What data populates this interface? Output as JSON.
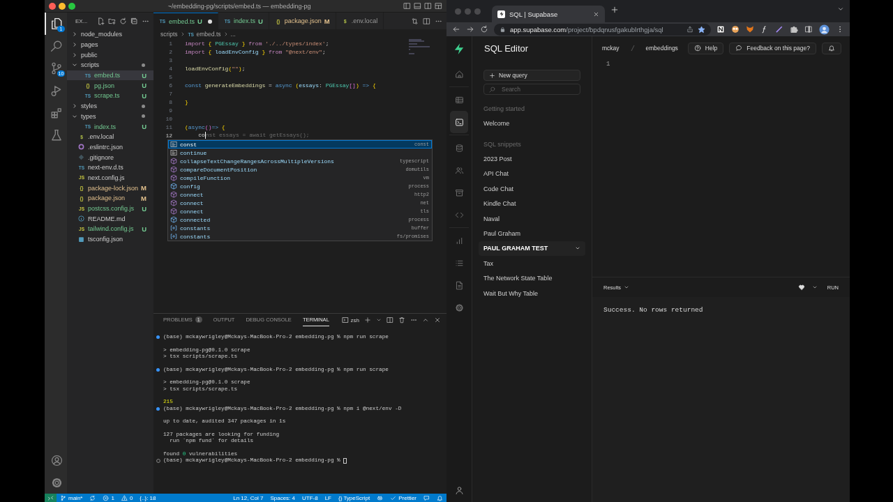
{
  "vscode": {
    "title": "~/embedding-pg/scripts/embed.ts — embedding-pg",
    "activity_bar": [
      {
        "kind": "explorer",
        "selected": true,
        "badge": "1"
      },
      {
        "kind": "search",
        "selected": false
      },
      {
        "kind": "source-control",
        "selected": false,
        "badge": "10"
      },
      {
        "kind": "run-debug",
        "selected": false
      },
      {
        "kind": "extensions",
        "selected": false
      },
      {
        "kind": "testing",
        "selected": false
      }
    ],
    "activity_bar_bottom": [
      {
        "kind": "account"
      },
      {
        "kind": "settings"
      }
    ],
    "explorer": {
      "title": "EX...",
      "tree": [
        {
          "label": "node_modules",
          "kind": "folder",
          "expanded": false,
          "modified": false,
          "selected": false
        },
        {
          "label": "pages",
          "kind": "folder",
          "expanded": false,
          "modified": false,
          "selected": false
        },
        {
          "label": "public",
          "kind": "folder",
          "expanded": false,
          "modified": false,
          "selected": false
        },
        {
          "label": "scripts",
          "kind": "folder",
          "expanded": true,
          "modified": true,
          "selected": false,
          "children": [
            {
              "label": "embed.ts",
              "kind": "ts",
              "icon_text": "TS",
              "status": "U",
              "color": "#73c991",
              "selected": true
            },
            {
              "label": "pg.json",
              "kind": "json",
              "icon_text": "{}",
              "status": "U",
              "color": "#73c991",
              "selected": false
            },
            {
              "label": "scrape.ts",
              "kind": "ts",
              "icon_text": "TS",
              "status": "U",
              "color": "#73c991",
              "selected": false
            }
          ]
        },
        {
          "label": "styles",
          "kind": "folder",
          "expanded": false,
          "modified": true,
          "selected": false
        },
        {
          "label": "types",
          "kind": "folder",
          "expanded": true,
          "modified": true,
          "selected": false,
          "children": [
            {
              "label": "index.ts",
              "kind": "ts",
              "icon_text": "TS",
              "status": "U",
              "color": "#73c991",
              "selected": false
            }
          ]
        },
        {
          "label": ".env.local",
          "kind": "env",
          "icon_text": "$",
          "selected": false
        },
        {
          "label": ".eslintrc.json",
          "kind": "eslint",
          "selected": false
        },
        {
          "label": ".gitignore",
          "kind": "git",
          "selected": false
        },
        {
          "label": "next-env.d.ts",
          "kind": "ts",
          "icon_text": "TS",
          "selected": false
        },
        {
          "label": "next.config.js",
          "kind": "js",
          "icon_text": "JS",
          "selected": false
        },
        {
          "label": "package-lock.json",
          "kind": "json",
          "icon_text": "{}",
          "status": "M",
          "color": "#e2c08d",
          "selected": false
        },
        {
          "label": "package.json",
          "kind": "json",
          "icon_text": "{}",
          "status": "M",
          "color": "#e2c08d",
          "selected": false
        },
        {
          "label": "postcss.config.js",
          "kind": "js",
          "icon_text": "JS",
          "status": "U",
          "color": "#73c991",
          "selected": false
        },
        {
          "label": "README.md",
          "kind": "info",
          "selected": false
        },
        {
          "label": "tailwind.config.js",
          "kind": "js",
          "icon_text": "JS",
          "status": "U",
          "color": "#73c991",
          "selected": false
        },
        {
          "label": "tsconfig.json",
          "kind": "tsconfig",
          "selected": false
        }
      ]
    },
    "tabs": [
      {
        "label": "embed.ts",
        "kind": "ts",
        "icon_text": "TS",
        "status": "U",
        "color": "#73c991",
        "dirty": true,
        "selected": true
      },
      {
        "label": "index.ts",
        "kind": "ts",
        "icon_text": "TS",
        "status": "U",
        "color": "#73c991",
        "dirty": false,
        "selected": false
      },
      {
        "label": "package.json",
        "kind": "json",
        "icon_text": "{}",
        "status": "M",
        "color": "#e2c08d",
        "dirty": false,
        "selected": false
      },
      {
        "label": ".env.local",
        "kind": "env",
        "icon_text": "$",
        "dirty": false,
        "selected": false
      }
    ],
    "breadcrumb": [
      {
        "label": "scripts"
      },
      {
        "label": "embed.ts",
        "icon_text": "TS"
      },
      {
        "label": "..."
      }
    ],
    "lines": [
      {
        "number": "1",
        "tokens": [
          {
            "text": "import ",
            "kind": "kw"
          },
          {
            "text": "{ ",
            "kind": "brace"
          },
          {
            "text": "PGEssay ",
            "kind": "type"
          },
          {
            "text": "} ",
            "kind": "brace"
          },
          {
            "text": "from ",
            "kind": "kw"
          },
          {
            "text": "'./../types/index'",
            "kind": "str"
          },
          {
            "text": ";",
            "kind": "plain"
          }
        ]
      },
      {
        "number": "2",
        "tokens": [
          {
            "text": "import ",
            "kind": "kw"
          },
          {
            "text": "{ ",
            "kind": "brace"
          },
          {
            "text": "loadEnvConfig ",
            "kind": "var"
          },
          {
            "text": "} ",
            "kind": "brace"
          },
          {
            "text": "from ",
            "kind": "kw"
          },
          {
            "text": "\"@next/env\"",
            "kind": "str"
          },
          {
            "text": ";",
            "kind": "plain"
          }
        ]
      },
      {
        "number": "3"
      },
      {
        "number": "4",
        "tokens": [
          {
            "text": "loadEnvConfig",
            "kind": "fn"
          },
          {
            "text": "(",
            "kind": "brace"
          },
          {
            "text": "\"\"",
            "kind": "str"
          },
          {
            "text": ")",
            "kind": "brace"
          },
          {
            "text": ";",
            "kind": "plain"
          }
        ]
      },
      {
        "number": "5"
      },
      {
        "number": "6",
        "tokens": [
          {
            "text": "const ",
            "kind": "storage"
          },
          {
            "text": "generateEmbeddings ",
            "kind": "fn"
          },
          {
            "text": "= ",
            "kind": "plain"
          },
          {
            "text": "async ",
            "kind": "storage"
          },
          {
            "text": "(",
            "kind": "brace"
          },
          {
            "text": "essays",
            "kind": "var"
          },
          {
            "text": ": ",
            "kind": "plain"
          },
          {
            "text": "PGEssay",
            "kind": "type"
          },
          {
            "text": "[]",
            "kind": "bracket"
          },
          {
            "text": ") ",
            "kind": "brace"
          },
          {
            "text": "=> ",
            "kind": "storage"
          },
          {
            "text": "{",
            "kind": "brace"
          }
        ]
      },
      {
        "number": "7"
      },
      {
        "number": "8",
        "tokens": [
          {
            "text": "}",
            "kind": "brace"
          }
        ]
      },
      {
        "number": "9"
      },
      {
        "number": "10"
      },
      {
        "number": "11",
        "tokens": [
          {
            "text": "(",
            "kind": "brace"
          },
          {
            "text": "async",
            "kind": "storage"
          },
          {
            "text": "()",
            "kind": "bracket"
          },
          {
            "text": "=> ",
            "kind": "storage"
          },
          {
            "text": "{",
            "kind": "brace"
          }
        ]
      },
      {
        "number": "12",
        "current": true,
        "tokens": [
          {
            "text": "    co",
            "kind": "plain"
          },
          {
            "text": "nst essays = await getEssays();",
            "kind": "ghost"
          }
        ]
      }
    ],
    "suggestions": [
      {
        "label": "const",
        "kind": "keyword",
        "detail": "const",
        "selected": true
      },
      {
        "label": "continue",
        "kind": "keyword",
        "selected": false
      },
      {
        "label": "collapseTextChangeRangesAcrossMultipleVersions",
        "kind": "method",
        "detail": "typescript",
        "selected": false
      },
      {
        "label": "compareDocumentPosition",
        "kind": "method",
        "detail": "domutils",
        "selected": false
      },
      {
        "label": "compileFunction",
        "kind": "method",
        "detail": "vm",
        "selected": false
      },
      {
        "label": "config",
        "kind": "property",
        "detail": "process",
        "selected": false
      },
      {
        "label": "connect",
        "kind": "method",
        "detail": "http2",
        "selected": false
      },
      {
        "label": "connect",
        "kind": "method",
        "detail": "net",
        "selected": false
      },
      {
        "label": "connect",
        "kind": "method",
        "detail": "tls",
        "selected": false
      },
      {
        "label": "connected",
        "kind": "property",
        "detail": "process",
        "selected": false
      },
      {
        "label": "constants",
        "kind": "variable",
        "detail": "buffer",
        "selected": false
      },
      {
        "label": "constants",
        "kind": "variable",
        "detail": "fs/promises",
        "selected": false
      }
    ],
    "panel_tabs": [
      {
        "label": "PROBLEMS",
        "badge": "1",
        "selected": false
      },
      {
        "label": "OUTPUT",
        "selected": false
      },
      {
        "label": "DEBUG CONSOLE",
        "selected": false
      },
      {
        "label": "TERMINAL",
        "selected": true
      }
    ],
    "terminal_name": "zsh",
    "terminal_blocks": [
      [
        {
          "text": "(base) mckaywrigley@Mckays-MacBook-Pro-2 embedding-pg % npm run scrape",
          "kind": "prompt-done"
        }
      ],
      [
        {
          "text": "> embedding-pg@0.1.0 scrape"
        },
        {
          "text": "> tsx scripts/scrape.ts"
        }
      ],
      [
        {
          "text": "(base) mckaywrigley@Mckays-MacBook-Pro-2 embedding-pg % npm run scrape",
          "kind": "prompt-done"
        }
      ],
      [
        {
          "text": "> embedding-pg@0.1.0 scrape"
        },
        {
          "text": "> tsx scripts/scrape.ts"
        }
      ],
      [
        {
          "segments": [
            {
              "text": "215",
              "kind": "number"
            }
          ]
        },
        {
          "text": "(base) mckaywrigley@Mckays-MacBook-Pro-2 embedding-pg % npm i @next/env -D",
          "kind": "prompt-done"
        }
      ],
      [
        {
          "text": "up to date, audited 347 packages in 1s"
        }
      ],
      [
        {
          "text": "127 packages are looking for funding"
        },
        {
          "text": "  run `npm fund` for details"
        }
      ],
      [
        {
          "segments": [
            {
              "text": "found ",
              "kind": "plain"
            },
            {
              "text": "0",
              "kind": "success"
            },
            {
              "text": " vulnerabilities",
              "kind": "plain"
            }
          ]
        },
        {
          "text": "(base) mckaywrigley@Mckays-MacBook-Pro-2 embedding-pg % ",
          "kind": "prompt-current",
          "cursor": true
        }
      ]
    ],
    "status_left": [
      {
        "kind": "remote"
      },
      {
        "kind": "branch",
        "text": "main*"
      },
      {
        "kind": "sync"
      },
      {
        "kind": "errors",
        "text": "1"
      },
      {
        "kind": "warnings",
        "text": "0"
      },
      {
        "kind": "text",
        "text": "{..}: 18"
      }
    ],
    "status_right": [
      {
        "kind": "text",
        "text": "Ln 12, Col 7"
      },
      {
        "kind": "text",
        "text": "Spaces: 4"
      },
      {
        "kind": "text",
        "text": "UTF-8"
      },
      {
        "kind": "text",
        "text": "LF"
      },
      {
        "kind": "text",
        "text": "{} TypeScript"
      },
      {
        "kind": "copilot"
      },
      {
        "kind": "check",
        "text": "Prettier"
      },
      {
        "kind": "feedback"
      },
      {
        "kind": "bell"
      }
    ]
  },
  "browser": {
    "tab_title": "SQL | Supabase",
    "url_host": "app.supabase.com",
    "url_path": "/project/bpdqnusfgakublrthgja/sql",
    "bookmarked": true
  },
  "supabase": {
    "nav": [
      {
        "items": [
          {
            "kind": "home",
            "selected": false
          }
        ]
      },
      {
        "items": [
          {
            "kind": "table",
            "selected": false
          },
          {
            "kind": "sql",
            "selected": true
          }
        ]
      },
      {
        "items": [
          {
            "kind": "database",
            "selected": false
          },
          {
            "kind": "users",
            "selected": false
          },
          {
            "kind": "storage",
            "selected": false
          },
          {
            "kind": "code",
            "selected": false
          }
        ]
      },
      {
        "items": [
          {
            "kind": "reports",
            "selected": false
          },
          {
            "kind": "logs",
            "selected": false
          },
          {
            "kind": "docs",
            "selected": false
          },
          {
            "kind": "settings",
            "selected": false
          }
        ]
      }
    ],
    "title": "SQL Editor",
    "new_query": "New query",
    "search": {
      "placeholder": "Search"
    },
    "sections": [
      {
        "title": "Getting started",
        "items": [
          {
            "label": "Welcome",
            "selected": false
          }
        ]
      },
      {
        "title": "SQL snippets",
        "items": [
          {
            "label": "2023 Post",
            "selected": false
          },
          {
            "label": "API Chat",
            "selected": false
          },
          {
            "label": "Code Chat",
            "selected": false
          },
          {
            "label": "Kindle Chat",
            "selected": false
          },
          {
            "label": "Naval",
            "selected": false
          },
          {
            "label": "Paul Graham",
            "selected": false
          },
          {
            "label": "PAUL GRAHAM TEST",
            "selected": true
          },
          {
            "label": "Tax",
            "selected": false
          },
          {
            "label": "The Network State Table",
            "selected": false
          },
          {
            "label": "Wait But Why Table",
            "selected": false
          }
        ]
      }
    ],
    "breadcrumb": [
      "mckay",
      "embeddings"
    ],
    "help": "Help",
    "feedback": "Feedback on this page?",
    "editor_lines": [
      "1"
    ],
    "results": {
      "tab": "Results",
      "run": "RUN",
      "message": "Success. No rows returned"
    }
  }
}
